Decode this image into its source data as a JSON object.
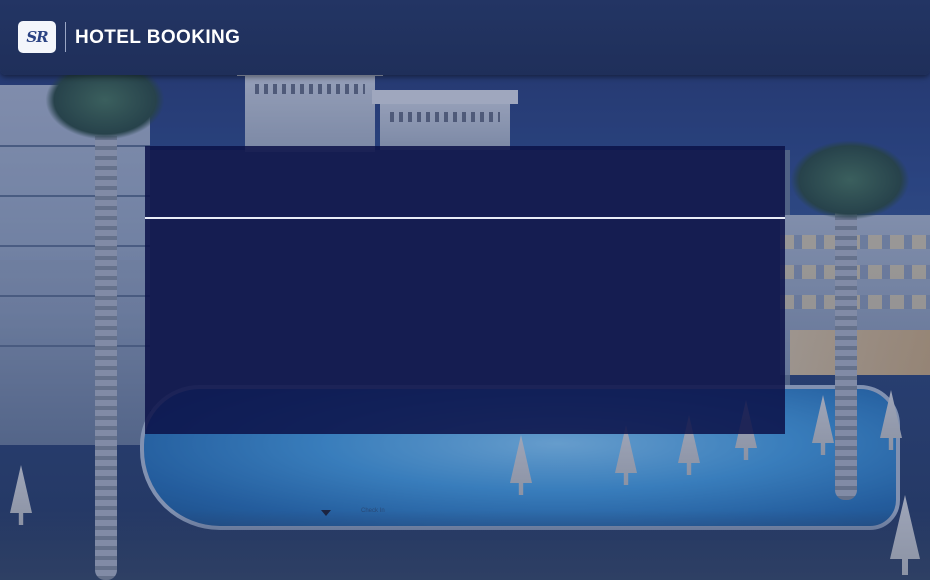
{
  "header": {
    "logo_text": "SR",
    "title": "HOTEL BOOKING"
  },
  "form": {
    "check_in_label": "Check In"
  },
  "icons": {
    "logo": "hotel-logo",
    "dropdown": "chevron-down-icon"
  },
  "colors": {
    "header_bg": "#1f2f5a",
    "panel_bg": "#0c1248",
    "divider": "#e8ecf6",
    "title_text": "#ffffff"
  }
}
